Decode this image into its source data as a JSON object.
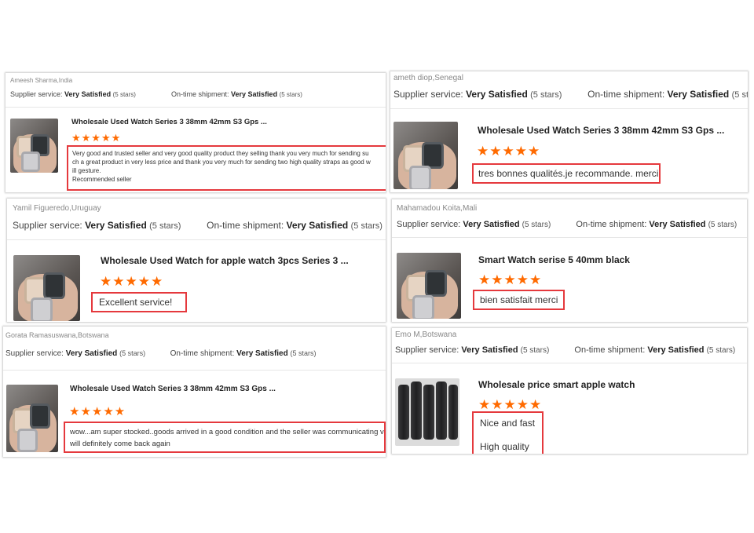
{
  "labels": {
    "supplier_service": "Supplier service:",
    "on_time_shipment": "On-time shipment:",
    "rating_value": "Very Satisfied",
    "stars_note": "(5 stars)",
    "stars_glyphs": "★★★★★"
  },
  "colors": {
    "star": "#ff6a00",
    "highlight_border": "#e5393d"
  },
  "reviews": [
    {
      "reviewer": "Ameesh Sharma,India",
      "product_title": "Wholesale Used Watch Series 3 38mm 42mm S3 Gps ...",
      "review_lines": [
        "Very good and trusted seller and very good quality product they selling thank you very much for sending su",
        "ch a great product in very less price and thank you very much for sending two high quality straps as good w",
        "ill gesture.",
        "Recommended seller"
      ],
      "rating_stars": 5,
      "thumbnail_icon": "watch-in-hand-image"
    },
    {
      "reviewer": "ameth diop,Senegal",
      "product_title": "Wholesale Used Watch Series 3 38mm 42mm S3 Gps ...",
      "review_lines": [
        "tres bonnes qualités.je recommande. merci"
      ],
      "rating_stars": 5,
      "thumbnail_icon": "watch-in-hand-image"
    },
    {
      "reviewer": "Yamil Figueredo,Uruguay",
      "product_title": "Wholesale Used Watch for apple watch 3pcs Series 3 ...",
      "review_lines": [
        "Excellent service!"
      ],
      "rating_stars": 5,
      "thumbnail_icon": "watch-in-hand-image"
    },
    {
      "reviewer": "Mahamadou Koita,Mali",
      "product_title": "Smart Watch serise 5 40mm black",
      "review_lines": [
        "bien satisfait merci"
      ],
      "rating_stars": 5,
      "thumbnail_icon": "watch-in-hand-image"
    },
    {
      "reviewer": "Gorata Ramasuswana,Botswana",
      "product_title": "Wholesale Used Watch Series 3 38mm 42mm S3 Gps ...",
      "review_lines": [
        "wow...am super stocked..goods arrived in a good condition and the seller was communicating very well",
        "will definitely come back again"
      ],
      "rating_stars": 5,
      "thumbnail_icon": "watch-in-hand-image"
    },
    {
      "reviewer": "Emo M,Botswana",
      "product_title": "Wholesale price smart apple watch",
      "review_lines": [
        "Nice and fast",
        "High quality"
      ],
      "rating_stars": 5,
      "thumbnail_icon": "boxed-watches-image"
    }
  ]
}
